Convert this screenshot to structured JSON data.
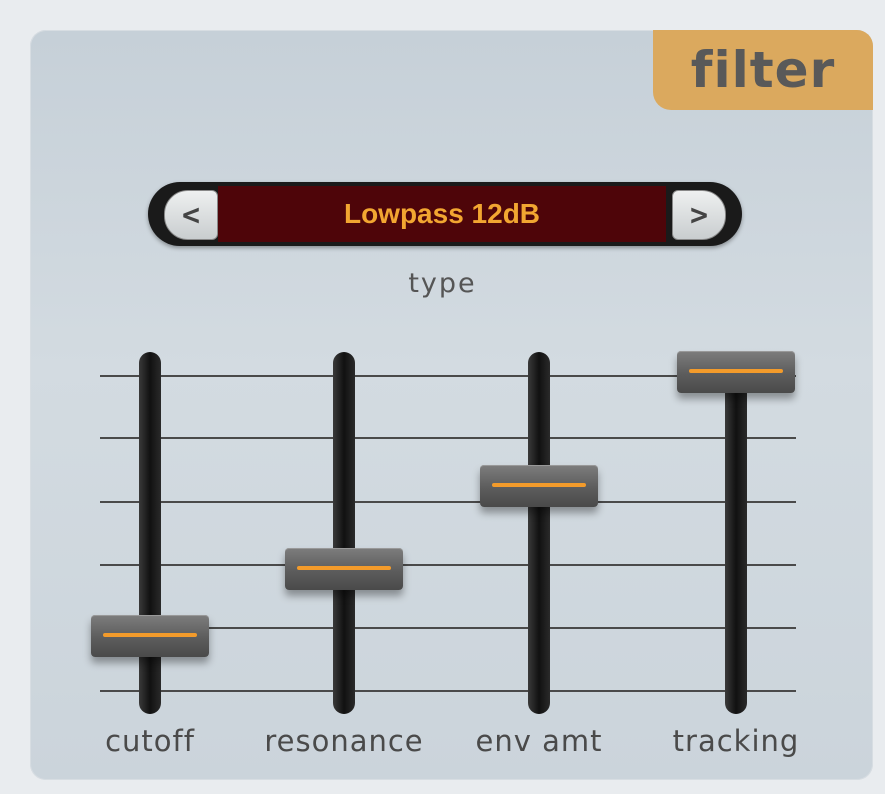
{
  "module": {
    "title": "filter"
  },
  "type_selector": {
    "value": "Lowpass 12dB",
    "prev_label": "<",
    "next_label": ">",
    "caption": "type"
  },
  "sliders": [
    {
      "label": "cutoff",
      "value": 0.17
    },
    {
      "label": "resonance",
      "value": 0.38
    },
    {
      "label": "env amt",
      "value": 0.64
    },
    {
      "label": "tracking",
      "value": 1.0
    }
  ],
  "colors": {
    "accent": "#f39b2b",
    "tag": "#dba95e",
    "display_bg": "#4e0509",
    "display_text": "#f2a631"
  }
}
